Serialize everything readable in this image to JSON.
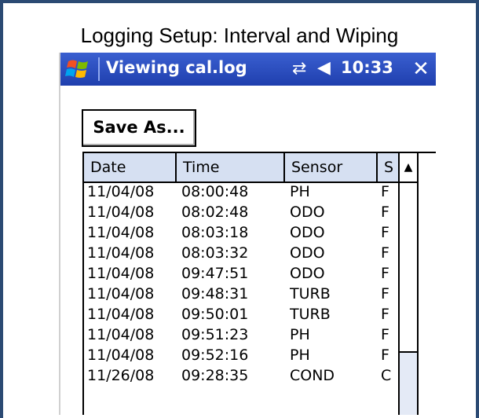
{
  "caption": "Logging Setup: Interval and Wiping",
  "window": {
    "title": "Viewing cal.log",
    "time": "10:33",
    "close_label": "✕"
  },
  "toolbar": {
    "save_as_label": "Save As..."
  },
  "table": {
    "columns": [
      "Date",
      "Time",
      "Sensor",
      "S"
    ],
    "rows": [
      [
        "11/04/08",
        "08:00:48",
        "PH",
        "F"
      ],
      [
        "11/04/08",
        "08:02:48",
        "ODO",
        "F"
      ],
      [
        "11/04/08",
        "08:03:18",
        "ODO",
        "F"
      ],
      [
        "11/04/08",
        "08:03:32",
        "ODO",
        "F"
      ],
      [
        "11/04/08",
        "09:47:51",
        "ODO",
        "F"
      ],
      [
        "11/04/08",
        "09:48:31",
        "TURB",
        "F"
      ],
      [
        "11/04/08",
        "09:50:01",
        "TURB",
        "F"
      ],
      [
        "11/04/08",
        "09:51:23",
        "PH",
        "F"
      ],
      [
        "11/04/08",
        "09:52:16",
        "PH",
        "F"
      ],
      [
        "11/26/08",
        "09:28:35",
        "COND",
        "C"
      ]
    ]
  },
  "colors": {
    "titlebar": "#2447c0",
    "header_bg": "#d6e0f2",
    "frame": "#2b4a73"
  },
  "icons": [
    "windows-start-icon",
    "network-icon",
    "speaker-icon",
    "close-icon",
    "scroll-up-arrow-icon"
  ]
}
